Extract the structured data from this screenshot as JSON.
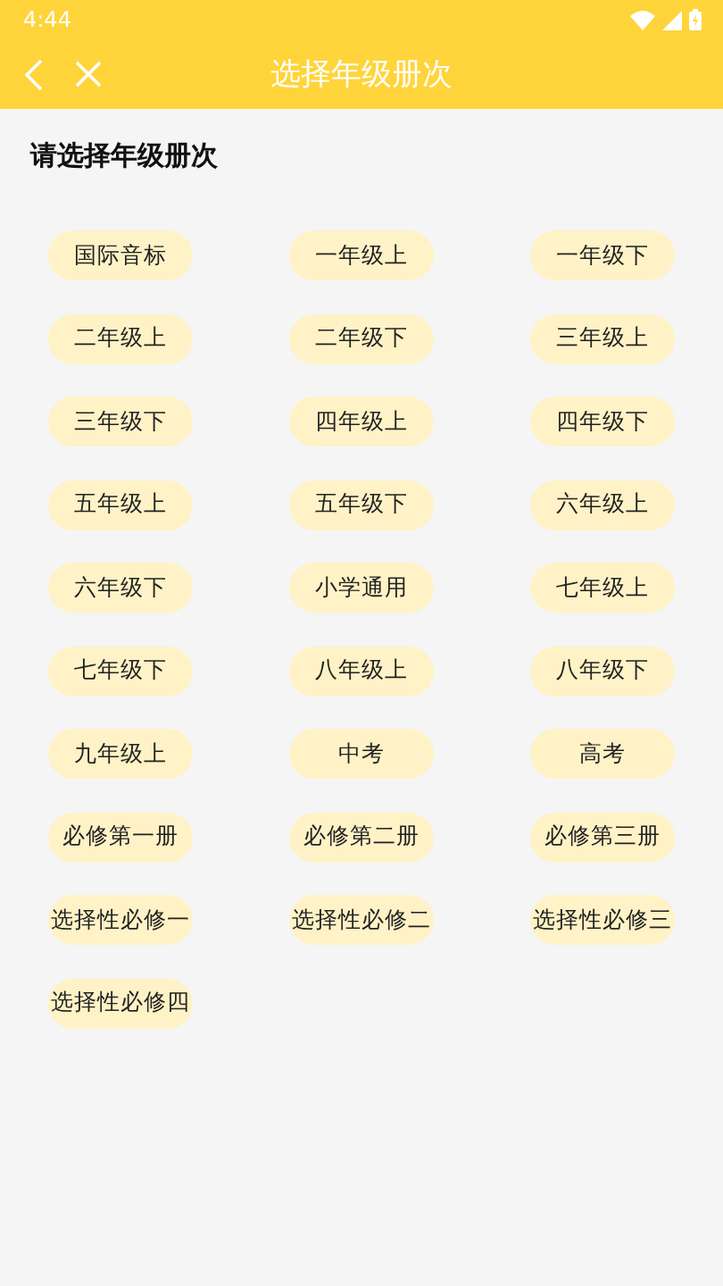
{
  "status_bar": {
    "time": "4:44"
  },
  "toolbar": {
    "title": "选择年级册次"
  },
  "prompt": "请选择年级册次",
  "grades": [
    "国际音标",
    "一年级上",
    "一年级下",
    "二年级上",
    "二年级下",
    "三年级上",
    "三年级下",
    "四年级上",
    "四年级下",
    "五年级上",
    "五年级下",
    "六年级上",
    "六年级下",
    "小学通用",
    "七年级上",
    "七年级下",
    "八年级上",
    "八年级下",
    "九年级上",
    "中考",
    "高考",
    "必修第一册",
    "必修第二册",
    "必修第三册",
    "选择性必修一",
    "选择性必修二",
    "选择性必修三",
    "选择性必修四"
  ]
}
